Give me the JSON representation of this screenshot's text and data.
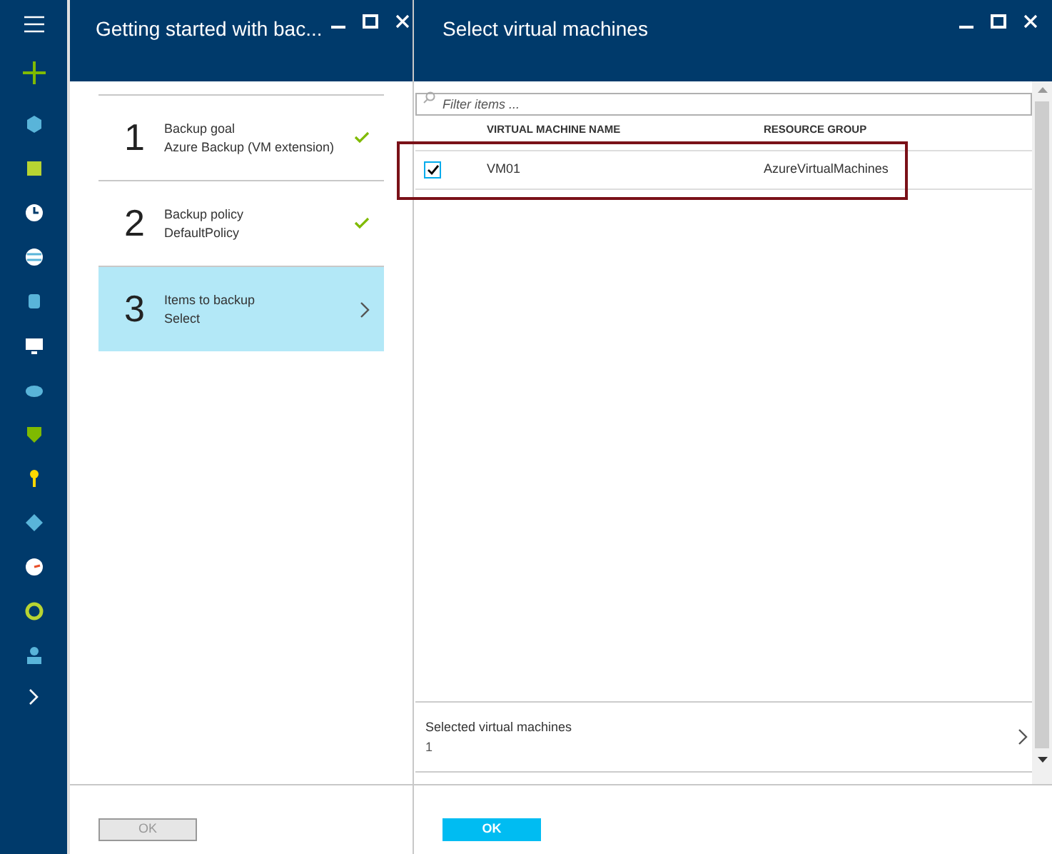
{
  "left_blade": {
    "title": "Getting started with bac...",
    "steps": [
      {
        "number": "1",
        "title": "Backup goal",
        "subtitle": "Azure Backup (VM extension)",
        "completed": true,
        "selected": false
      },
      {
        "number": "2",
        "title": "Backup policy",
        "subtitle": "DefaultPolicy",
        "completed": true,
        "selected": false
      },
      {
        "number": "3",
        "title": "Items to backup",
        "subtitle": "Select",
        "completed": false,
        "selected": true
      }
    ],
    "ok_button": {
      "label": "OK",
      "disabled": true
    }
  },
  "right_blade": {
    "title": "Select virtual machines",
    "filter": {
      "placeholder": "Filter items ..."
    },
    "table": {
      "columns": [
        "VIRTUAL MACHINE NAME",
        "RESOURCE GROUP"
      ],
      "rows": [
        {
          "checked": true,
          "highlighted": true,
          "name": "VM01",
          "resource_group": "AzureVirtualMachines"
        }
      ]
    },
    "summary": {
      "label": "Selected virtual machines",
      "value": "1"
    },
    "ok_button": {
      "label": "OK",
      "disabled": false
    }
  }
}
